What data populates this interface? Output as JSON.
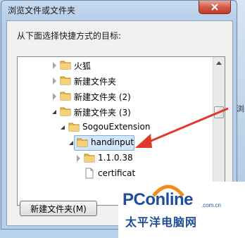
{
  "dialog": {
    "title": "浏览文件或文件夹",
    "instruction": "从下面选择快捷方式的目标:",
    "new_folder_button": "新建文件夹(M)"
  },
  "tree": {
    "items": [
      {
        "label": "火狐",
        "state": "collapsed",
        "icon": "folder-icon"
      },
      {
        "label": "新建文件夹",
        "state": "collapsed",
        "icon": "folder-icon"
      },
      {
        "label": "新建文件夹 (2)",
        "state": "collapsed",
        "icon": "folder-icon"
      },
      {
        "label": "新建文件夹 (3)",
        "state": "expanded",
        "icon": "folder-icon"
      },
      {
        "label": "SogouExtension",
        "state": "expanded",
        "icon": "folder-icon"
      },
      {
        "label": "handinput",
        "state": "selected",
        "icon": "folder-icon"
      },
      {
        "label": "1.1.0.38",
        "state": "collapsed",
        "icon": "folder-icon"
      },
      {
        "label": "certificat",
        "state": "none",
        "icon": "file-icon"
      }
    ]
  },
  "background": {
    "right_label": "浏"
  },
  "watermark": {
    "logo": "PConline",
    "dotcom": ".com.cn",
    "subtitle": "太平洋电脑网"
  },
  "colors": {
    "annotation_arrow": "#e0392b",
    "selection": "#d4e6fa",
    "logo_blue": "#1e4e9a",
    "logo_orange": "#f28c1c"
  }
}
